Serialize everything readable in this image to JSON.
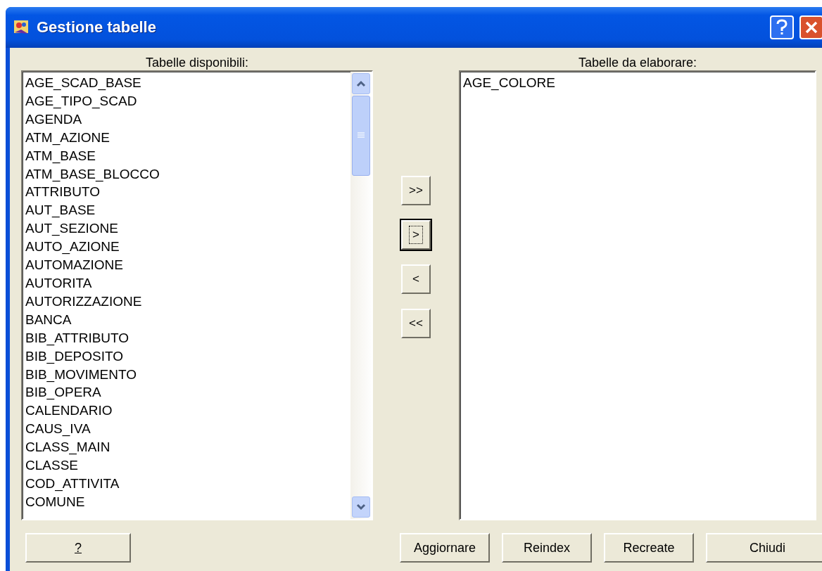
{
  "window": {
    "title": "Gestione tabelle"
  },
  "available": {
    "label": "Tabelle disponibili:",
    "items": [
      "AGE_SCAD_BASE",
      "AGE_TIPO_SCAD",
      "AGENDA",
      "ATM_AZIONE",
      "ATM_BASE",
      "ATM_BASE_BLOCCO",
      "ATTRIBUTO",
      "AUT_BASE",
      "AUT_SEZIONE",
      "AUTO_AZIONE",
      "AUTOMAZIONE",
      "AUTORITA",
      "AUTORIZZAZIONE",
      "BANCA",
      "BIB_ATTRIBUTO",
      "BIB_DEPOSITO",
      "BIB_MOVIMENTO",
      "BIB_OPERA",
      "CALENDARIO",
      "CAUS_IVA",
      "CLASS_MAIN",
      "CLASSE",
      "COD_ATTIVITA",
      "COMUNE"
    ]
  },
  "move_buttons": [
    {
      "label": ">>",
      "focused": false
    },
    {
      "label": ">",
      "focused": true
    },
    {
      "label": "<",
      "focused": false
    },
    {
      "label": "<<",
      "focused": false
    }
  ],
  "selected_tables": {
    "label": "Tabelle da elaborare:",
    "items": [
      "AGE_COLORE"
    ]
  },
  "help_button": "?",
  "buttons": [
    "Aggiornare",
    "Reindex",
    "Recreate",
    "Chiudi"
  ]
}
